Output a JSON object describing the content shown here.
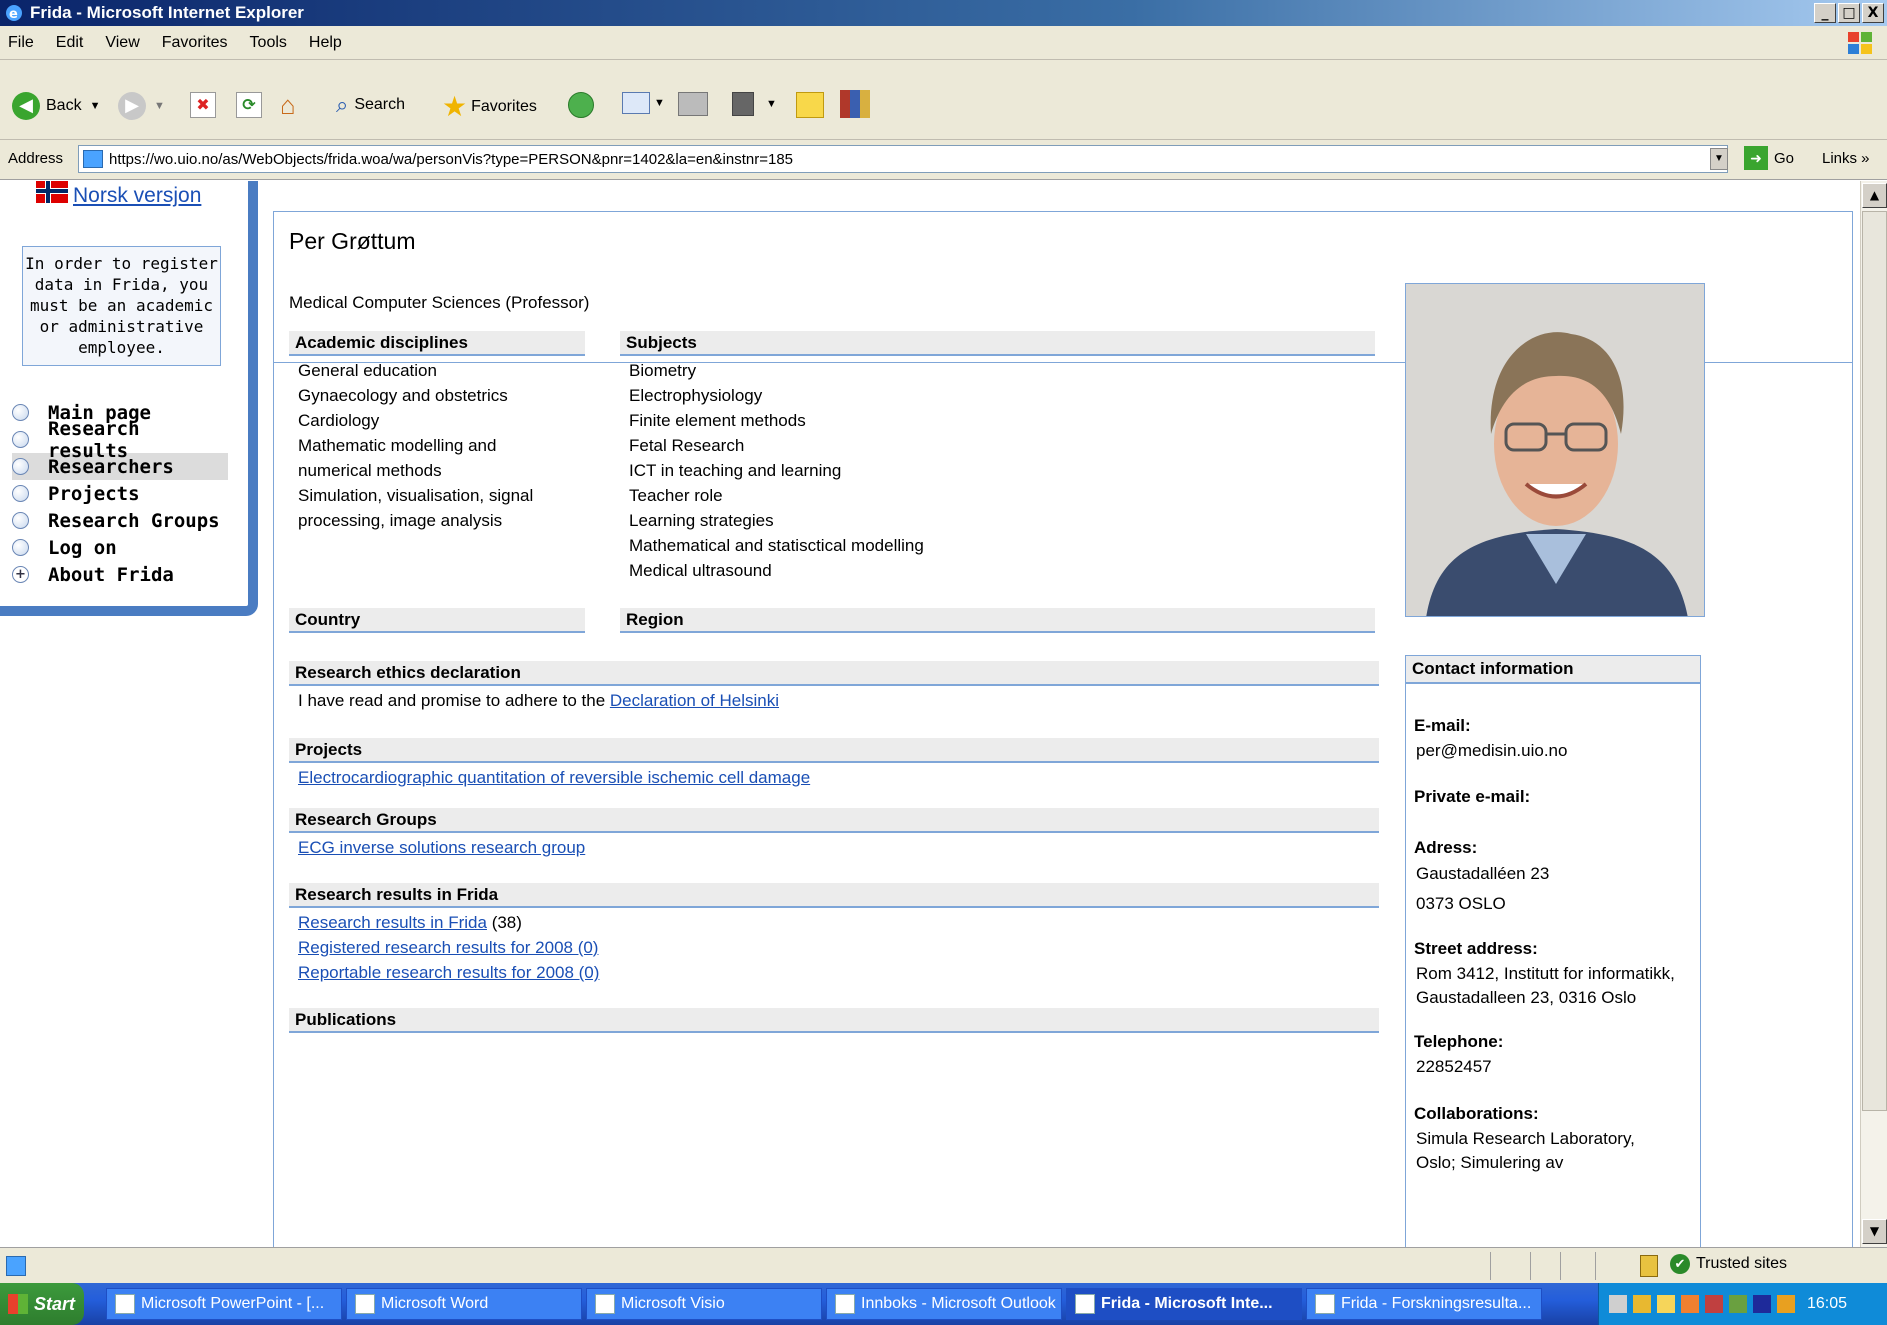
{
  "window": {
    "title": "Frida - Microsoft Internet Explorer",
    "controls": [
      "_",
      "□",
      "X"
    ]
  },
  "menu": [
    "File",
    "Edit",
    "View",
    "Favorites",
    "Tools",
    "Help"
  ],
  "toolbar": {
    "back": "Back",
    "search": "Search",
    "favorites": "Favorites"
  },
  "address": {
    "label": "Address",
    "url": "https://wo.uio.no/as/WebObjects/frida.woa/wa/personVis?type=PERSON&pnr=1402&la=en&instnr=185",
    "go": "Go",
    "links": "Links »"
  },
  "sidebar": {
    "language_link": "Norsk versjon",
    "notice": [
      "In order to register",
      "data in Frida, you",
      "must be an academic",
      "or administrative",
      "employee."
    ],
    "items": [
      {
        "label": "Main page",
        "selected": false
      },
      {
        "label": "Research results",
        "selected": false
      },
      {
        "label": "Researchers",
        "selected": true
      },
      {
        "label": "Projects",
        "selected": false
      },
      {
        "label": "Research Groups",
        "selected": false
      },
      {
        "label": "Log on",
        "selected": false
      },
      {
        "label": "About Frida",
        "selected": false
      }
    ]
  },
  "person": {
    "name": "Per Grøttum",
    "position": "Medical Computer Sciences (Professor)"
  },
  "academic_disciplines": {
    "heading": "Academic disciplines",
    "items": [
      "General education",
      "Gynaecology and obstetrics",
      "Cardiology",
      "Mathematic modelling and",
      "numerical methods",
      "Simulation, visualisation, signal",
      "processing, image analysis"
    ]
  },
  "subjects": {
    "heading": "Subjects",
    "items": [
      "Biometry",
      "Electrophysiology",
      "Finite element methods",
      "Fetal Research",
      "ICT in teaching and learning",
      "Teacher role",
      "Learning strategies",
      "Mathematical and statisctical modelling",
      "Medical ultrasound"
    ]
  },
  "country": {
    "heading": "Country"
  },
  "region": {
    "heading": "Region"
  },
  "ethics": {
    "heading": "Research ethics declaration",
    "text": "I have read and promise to adhere to the ",
    "link": "Declaration of Helsinki"
  },
  "projects": {
    "heading": "Projects",
    "link": "Electrocardiographic quantitation of reversible ischemic cell damage"
  },
  "groups": {
    "heading": "Research Groups",
    "link": "ECG inverse solutions research group"
  },
  "results": {
    "heading": "Research results in Frida",
    "link1": "Research results in Frida",
    "count1": " (38)",
    "link2": "Registered research results for  2008 (0)",
    "link3": "Reportable research results for  2008 (0)"
  },
  "publications": {
    "heading": "Publications"
  },
  "contact": {
    "title": "Contact information",
    "email_label": "E-mail:",
    "email": "per@medisin.uio.no",
    "private_label": "Private e-mail:",
    "address_label": "Adress:",
    "address1": "Gaustadalléen 23",
    "address2": "0373 OSLO",
    "street_label": "Street address:",
    "street1": "Rom 3412, Institutt for informatikk,",
    "street2": "Gaustadalleen 23, 0316 Oslo",
    "phone_label": "Telephone:",
    "phone": "22852457",
    "collab_label": "Collaborations:",
    "collab1": "Simula Research Laboratory,",
    "collab2": "Oslo; Simulering av"
  },
  "status": {
    "zone": "Trusted sites"
  },
  "taskbar": {
    "start": "Start",
    "tasks": [
      "Microsoft PowerPoint - [...",
      "Microsoft Word",
      "Microsoft Visio",
      "Innboks - Microsoft Outlook",
      "Frida - Microsoft Inte...",
      "Frida - Forskningsresulta..."
    ],
    "clock": "16:05"
  }
}
